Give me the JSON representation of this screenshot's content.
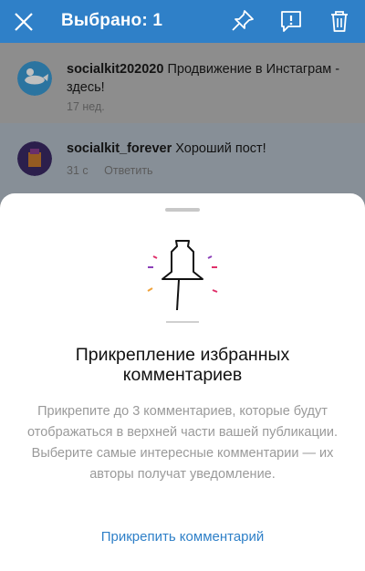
{
  "topbar": {
    "title": "Выбрано: 1",
    "icons": [
      "close-icon",
      "pin-icon",
      "report-icon",
      "trash-icon"
    ],
    "background": "#2f80c8"
  },
  "comments": [
    {
      "username": "socialkit202020",
      "text": "Продвижение в Инстаграм - здесь!",
      "time": "17 нед.",
      "reply": ""
    },
    {
      "username": "socialkit_forever",
      "text": "Хороший пост!",
      "time": "31 с",
      "reply": "Ответить"
    }
  ],
  "sheet": {
    "title": "Прикрепление избранных комментариев",
    "description": "Прикрепите до 3 комментариев, которые будут отображаться в верхней части вашей публикации. Выберите самые интересные комментарии — их авторы получат уведомление.",
    "action": "Прикрепить комментарий"
  },
  "colors": {
    "accent": "#2f80c8",
    "selected_row": "#b4bfca"
  }
}
